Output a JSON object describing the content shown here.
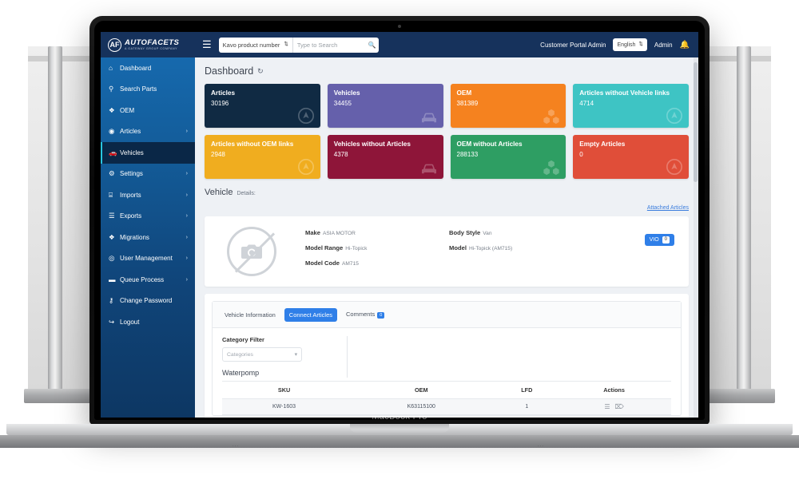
{
  "device": {
    "label": "MacBook Pro"
  },
  "app": {
    "logo": {
      "name": "AUTOFACETS",
      "tagline": "A GATEWAY GROUP COMPANY",
      "mark": "AF"
    },
    "topbar": {
      "menu_icon": "hamburger-icon",
      "search_scope": "Kavo product number",
      "search_placeholder": "Type to Search",
      "search_value": "",
      "search_icon": "search-icon",
      "account_label": "Customer Portal Admin",
      "language": "English",
      "user": "Admin",
      "notification_icon": "bell-icon"
    },
    "sidebar": {
      "items": [
        {
          "label": "Dashboard",
          "icon": "home-icon",
          "chevron": "",
          "active": false
        },
        {
          "label": "Search Parts",
          "icon": "search-icon",
          "chevron": "",
          "active": false
        },
        {
          "label": "OEM",
          "icon": "boxes-icon",
          "chevron": "",
          "active": false
        },
        {
          "label": "Articles",
          "icon": "circle-icon",
          "chevron": "›",
          "active": false
        },
        {
          "label": "Vehicles",
          "icon": "car-icon",
          "chevron": "",
          "active": true
        },
        {
          "label": "Settings",
          "icon": "gear-icon",
          "chevron": "›",
          "active": false
        },
        {
          "label": "Imports",
          "icon": "server-icon",
          "chevron": "›",
          "active": false
        },
        {
          "label": "Exports",
          "icon": "file-icon",
          "chevron": "›",
          "active": false
        },
        {
          "label": "Migrations",
          "icon": "boxes-icon",
          "chevron": "›",
          "active": false
        },
        {
          "label": "User Management",
          "icon": "user-icon",
          "chevron": "›",
          "active": false
        },
        {
          "label": "Queue Process",
          "icon": "briefcase-icon",
          "chevron": "›",
          "active": false
        },
        {
          "label": "Change Password",
          "icon": "key-icon",
          "chevron": "",
          "active": false
        },
        {
          "label": "Logout",
          "icon": "logout-icon",
          "chevron": "",
          "active": false
        }
      ]
    },
    "main": {
      "title": "Dashboard",
      "refresh_icon": "refresh-icon",
      "cards": [
        {
          "label": "Articles",
          "value": "30196",
          "color": "#102a43",
          "icon": "articles-icon"
        },
        {
          "label": "Vehicles",
          "value": "34455",
          "color": "#6560ab",
          "icon": "car-icon"
        },
        {
          "label": "OEM",
          "value": "381389",
          "color": "#f5821f",
          "icon": "boxes-icon"
        },
        {
          "label": "Articles without Vehicle links",
          "value": "4714",
          "color": "#3ec4c4",
          "icon": "articles-icon"
        },
        {
          "label": "Articles without OEM links",
          "value": "2948",
          "color": "#f0ad1f",
          "icon": "articles-icon"
        },
        {
          "label": "Vehicles without Articles",
          "value": "4378",
          "color": "#8e1539",
          "icon": "car-icon"
        },
        {
          "label": "OEM without Articles",
          "value": "288133",
          "color": "#2e9e63",
          "icon": "boxes-icon"
        },
        {
          "label": "Empty Articles",
          "value": "0",
          "color": "#e04e39",
          "icon": "articles-icon"
        }
      ],
      "vehicle_section": {
        "heading": "Vehicle",
        "subheading": "Details:",
        "attached_link": "Attached Articles",
        "image_icon": "no-photo-icon",
        "specs_left": [
          {
            "label": "Make",
            "value": "ASIA MOTOR"
          },
          {
            "label": "Model Range",
            "value": "Hi-Topick"
          },
          {
            "label": "Model Code",
            "value": "AM715"
          }
        ],
        "specs_right": [
          {
            "label": "Body Style",
            "value": "Van"
          },
          {
            "label": "Model",
            "value": "Hi-Topick (AM715)"
          }
        ],
        "vio_button": {
          "label": "VIO",
          "badge": "0"
        }
      },
      "tabs": [
        {
          "label": "Vehicle Information",
          "active": false,
          "badge": ""
        },
        {
          "label": "Connect Articles",
          "active": true,
          "badge": ""
        },
        {
          "label": "Comments",
          "active": false,
          "badge": "0"
        }
      ],
      "filter": {
        "label": "Category Filter",
        "placeholder": "Categories",
        "value": "",
        "chevron_icon": "chevron-down-icon"
      },
      "table": {
        "group_title": "Waterpomp",
        "columns": [
          "SKU",
          "OEM",
          "LFD",
          "Actions"
        ],
        "rows": [
          {
            "sku": "KW-1603",
            "oem": "K63115100",
            "lfd": "1",
            "actions": [
              "list-icon",
              "trash-icon"
            ]
          }
        ]
      }
    },
    "scrollbar": {
      "name": "vertical-scrollbar"
    }
  }
}
